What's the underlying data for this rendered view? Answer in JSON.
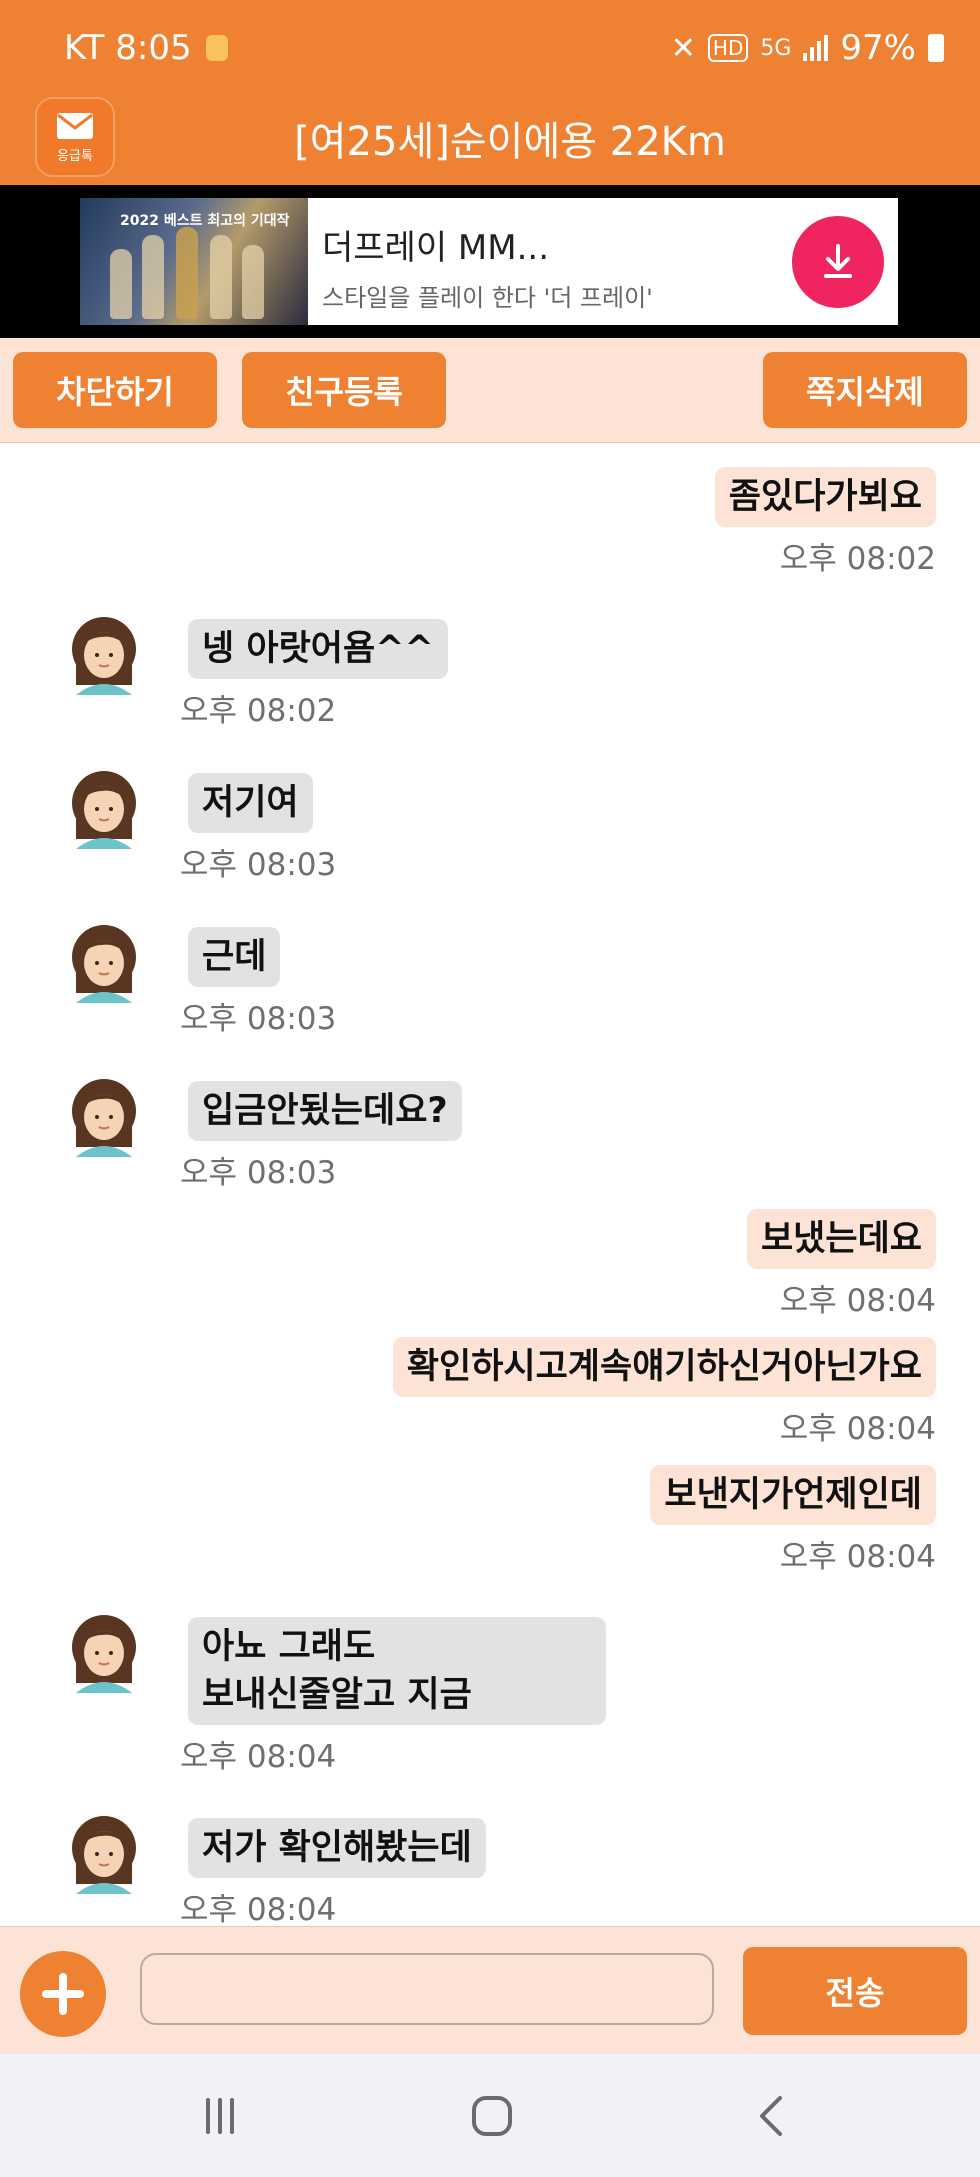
{
  "status_bar": {
    "carrier_time": "KT 8:05",
    "network": "5G",
    "battery": "97%"
  },
  "header": {
    "app_logo_text": "응급톡",
    "title": "[여25세]순이에용 22Km"
  },
  "ad": {
    "image_caption": "2022 베스트 최고의 기대작",
    "title": "더프레이 MM...",
    "subtitle": "스타일을 플레이 한다 '더 프레이'"
  },
  "actions": {
    "block_label": "차단하기",
    "add_friend_label": "친구등록",
    "delete_label": "쪽지삭제"
  },
  "messages": [
    {
      "direction": "out",
      "text": "좀있다가뵈요",
      "time": "오후 08:02"
    },
    {
      "direction": "in",
      "text": "넹 아랏어욤^^",
      "time": "오후 08:02"
    },
    {
      "direction": "in",
      "text": "저기여",
      "time": "오후 08:03"
    },
    {
      "direction": "in",
      "text": "근데",
      "time": "오후 08:03"
    },
    {
      "direction": "in",
      "text": "입금안됬는데요?",
      "time": "오후 08:03"
    },
    {
      "direction": "out",
      "text": "보냈는데요",
      "time": "오후 08:04"
    },
    {
      "direction": "out",
      "text": "확인하시고계속얘기하신거아닌가요",
      "time": "오후 08:04"
    },
    {
      "direction": "out",
      "text": "보낸지가언제인데",
      "time": "오후 08:04"
    },
    {
      "direction": "in",
      "text": [
        "아뇨 그래도",
        "보내신줄알고 지금"
      ],
      "time": "오후 08:04"
    },
    {
      "direction": "in",
      "text": "저가 확인해봤는데",
      "time": "오후 08:04"
    }
  ],
  "composer": {
    "input_value": "",
    "send_label": "전송"
  },
  "colors": {
    "accent": "#ee8132",
    "outgoing_bubble": "#fce3d6",
    "incoming_bubble": "#e2e2e2",
    "ad_download": "#f0245e"
  }
}
